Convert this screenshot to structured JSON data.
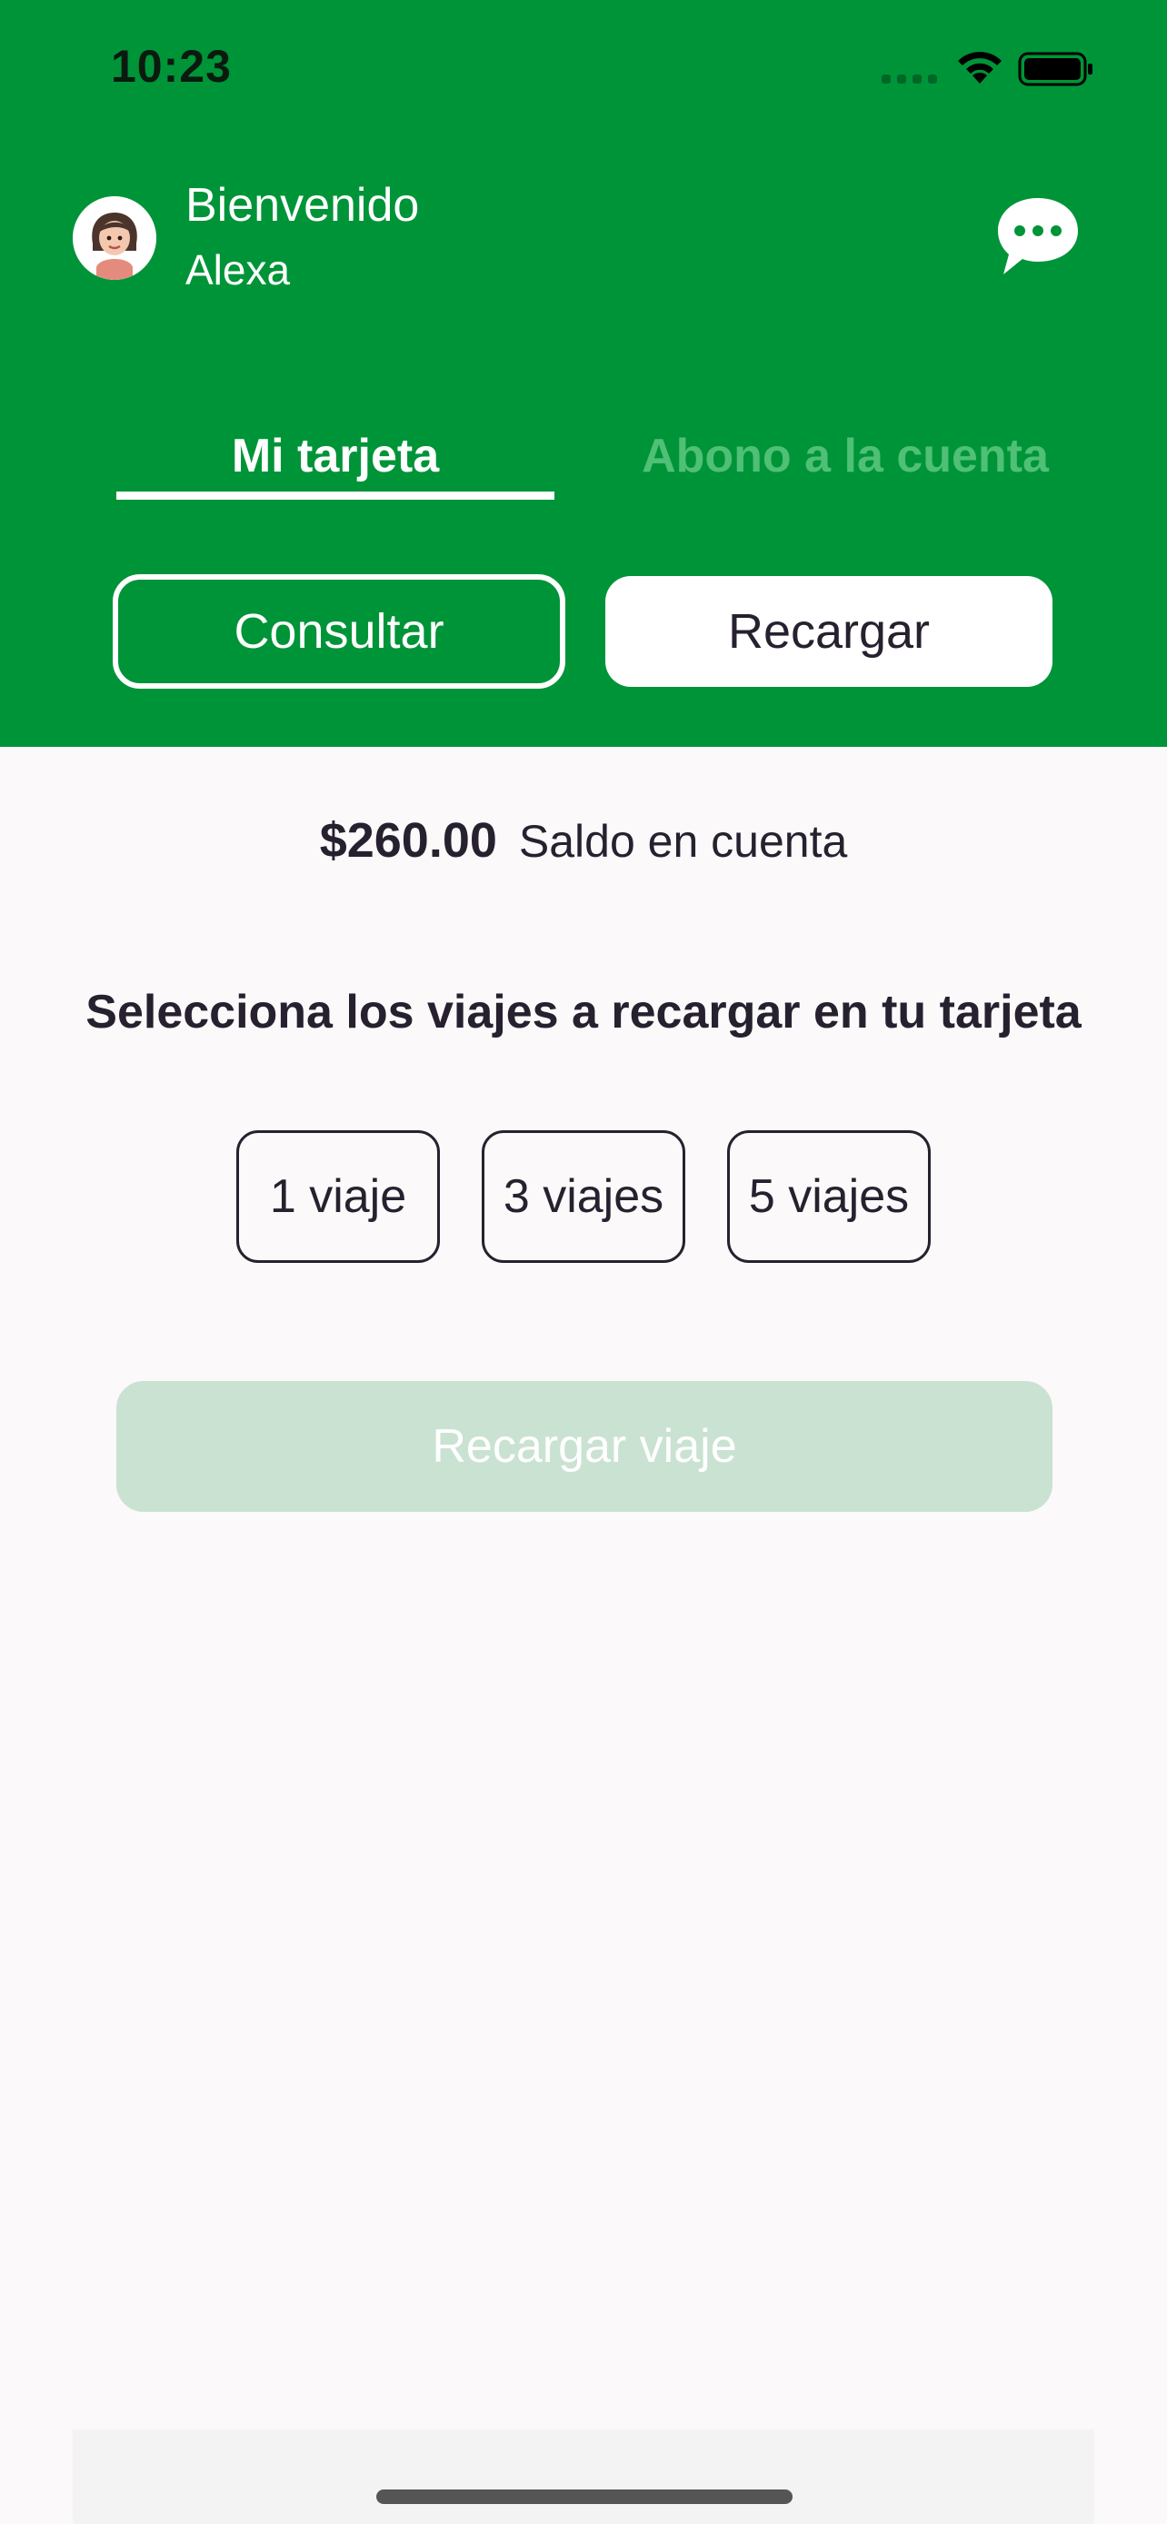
{
  "status_bar": {
    "time": "10:23"
  },
  "header": {
    "greeting": "Bienvenido",
    "user_name": "Alexa",
    "avatar_icon": "memoji-avatar",
    "chat_icon": "chat-bubble-icon",
    "background_color": "#009438"
  },
  "tabs": [
    {
      "label": "Mi tarjeta",
      "active": true
    },
    {
      "label": "Abono a la cuenta",
      "active": false
    }
  ],
  "actions": {
    "consult_label": "Consultar",
    "recharge_label": "Recargar"
  },
  "balance": {
    "amount": "$260.00",
    "label": "Saldo en cuenta"
  },
  "trip_selection": {
    "title": "Selecciona los viajes a recargar en tu tarjeta",
    "options": [
      "1 viaje",
      "3 viajes",
      "5 viajes"
    ]
  },
  "recharge_trip_button": {
    "label": "Recargar viaje",
    "enabled": false
  }
}
